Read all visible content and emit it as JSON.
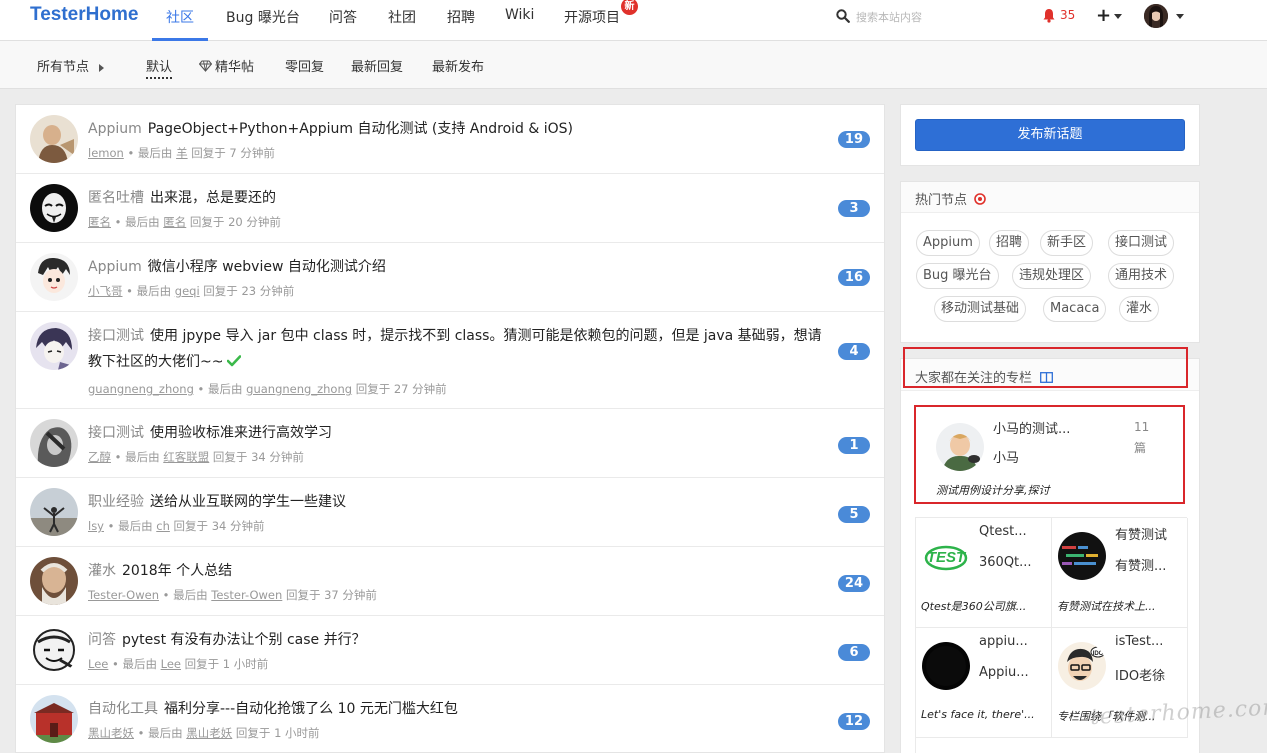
{
  "header": {
    "brand": "TesterHome",
    "nav": [
      {
        "label": "社区",
        "active": true
      },
      {
        "label": "Bug 曝光台"
      },
      {
        "label": "问答"
      },
      {
        "label": "社团"
      },
      {
        "label": "招聘"
      },
      {
        "label": "Wiki"
      },
      {
        "label": "开源项目"
      }
    ],
    "new_badge": "新",
    "search_placeholder": "搜索本站内容",
    "notification_count": "35",
    "plus_label": "+"
  },
  "subnav": {
    "all_nodes": "所有节点",
    "tabs": [
      "默认",
      "精华帖",
      "零回复",
      "最新回复",
      "最新发布"
    ],
    "active_tab": "默认"
  },
  "topics": [
    {
      "node": "Appium",
      "title": "PageObject+Python+Appium 自动化测试 (支持 Android & iOS)",
      "author": "lemon",
      "last_by_label": "最后由",
      "last_user": "羊",
      "time": "回复于 7 分钟前",
      "replies": "19"
    },
    {
      "node": "匿名吐槽",
      "title": "出来混，总是要还的",
      "author": "匿名",
      "last_by_label": "最后由",
      "last_user": "匿名",
      "time": "回复于 20 分钟前",
      "replies": "3"
    },
    {
      "node": "Appium",
      "title": "微信小程序 webview 自动化测试介绍",
      "author": "小飞哥",
      "last_by_label": "最后由",
      "last_user": "geqi",
      "time": "回复于 23 分钟前",
      "replies": "16"
    },
    {
      "node": "接口测试",
      "title": "使用 jpype 导入 jar 包中 class 时，提示找不到 class。猜测可能是依赖包的问题，但是 java 基础弱，想请教下社区的大佬们~~",
      "author": "guangneng_zhong",
      "last_by_label": "最后由",
      "last_user": "guangneng_zhong",
      "time": "回复于 27 分钟前",
      "replies": "4",
      "solved": true
    },
    {
      "node": "接口测试",
      "title": "使用验收标准来进行高效学习",
      "author": "乙醇",
      "last_by_label": "最后由",
      "last_user": "红客联盟",
      "time": "回复于 34 分钟前",
      "replies": "1"
    },
    {
      "node": "职业经验",
      "title": "送给从业互联网的学生一些建议",
      "author": "lsy",
      "last_by_label": "最后由",
      "last_user": "ch",
      "time": "回复于 34 分钟前",
      "replies": "5"
    },
    {
      "node": "灌水",
      "title": "2018年 个人总结",
      "author": "Tester-Owen",
      "last_by_label": "最后由",
      "last_user": "Tester-Owen",
      "time": "回复于 37 分钟前",
      "replies": "24"
    },
    {
      "node": "问答",
      "title": "pytest 有没有办法让个别 case 并行？",
      "author": "Lee",
      "last_by_label": "最后由",
      "last_user": "Lee",
      "time": "回复于 1 小时前",
      "replies": "6"
    },
    {
      "node": "自动化工具",
      "title": "福利分享---自动化抢饿了么 10 元无门槛大红包",
      "author": "黑山老妖",
      "last_by_label": "最后由",
      "last_user": "黑山老妖",
      "time": "回复于 1 小时前",
      "replies": "12"
    }
  ],
  "sidebar": {
    "new_topic_button": "发布新话题",
    "hot_nodes_title": "热门节点",
    "hot_nodes": [
      "Appium",
      "招聘",
      "新手区",
      "接口测试",
      "Bug 曝光台",
      "违规处理区",
      "通用技术",
      "移动测试基础",
      "Macaca",
      "灌水"
    ],
    "columns_title": "大家都在关注的专栏",
    "featured_column": {
      "title": "小马的测试...",
      "author": "小马",
      "count": "11",
      "count_unit": "篇",
      "desc": "测试用例设计分享,探讨"
    },
    "columns": [
      {
        "title": "Qtest...",
        "author": "360Qt...",
        "desc": "Qtest是360公司旗..."
      },
      {
        "title": "有赞测试",
        "author": "有赞测...",
        "desc": "有赞测试在技术上..."
      },
      {
        "title": "appiu...",
        "author": "Appiu...",
        "desc": "Let's face it, there'..."
      },
      {
        "title": "isTest...",
        "author": "IDO老徐",
        "desc": "专栏围绕「软件测..."
      }
    ]
  },
  "watermark": "testerhome.com"
}
